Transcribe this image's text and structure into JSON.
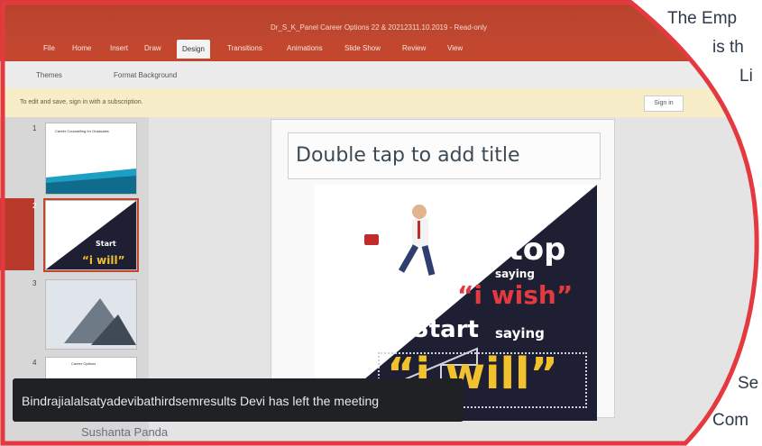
{
  "window": {
    "doc_title": "Dr_S_K_Panel Career Options 22 & 20212311.10.2019 - Read-only",
    "tabs": [
      "File",
      "Home",
      "Insert",
      "Draw",
      "Design",
      "Transitions",
      "Animations",
      "Slide Show",
      "Review",
      "View"
    ],
    "active_tab": "Design"
  },
  "ribbon": {
    "themes": "Themes",
    "format_background": "Format Background"
  },
  "notice": {
    "text": "To edit and save, sign in with a subscription.",
    "sign_in": "Sign in"
  },
  "thumbnails": [
    {
      "num": "1",
      "title": "Career Counselling for Graduates"
    },
    {
      "num": "2",
      "title": "Start saying “i will”"
    },
    {
      "num": "3",
      "title": ""
    },
    {
      "num": "4",
      "title": "Career Options"
    }
  ],
  "slide": {
    "title_placeholder": "Double tap to add title",
    "art": {
      "stop": "Stop",
      "saying1": "saying",
      "wish": "“i wish”",
      "start": "Start",
      "saying2": "saying",
      "will": "“i will”"
    }
  },
  "toast": {
    "text": "Bindrajialalsatyadevibathirdsemresults Devi has left the meeting"
  },
  "bottom_user": "Sushanta Panda",
  "caption": {
    "line1": "The Emp",
    "line2": "is th",
    "line3": "Li",
    "line4": "Se",
    "line5": "Com"
  },
  "colors": {
    "ppt_red": "#c2472e",
    "border_red": "#e43a3f",
    "toast_bg": "#202124",
    "wish_red": "#e43a3f",
    "will_yellow": "#f2c12e"
  }
}
